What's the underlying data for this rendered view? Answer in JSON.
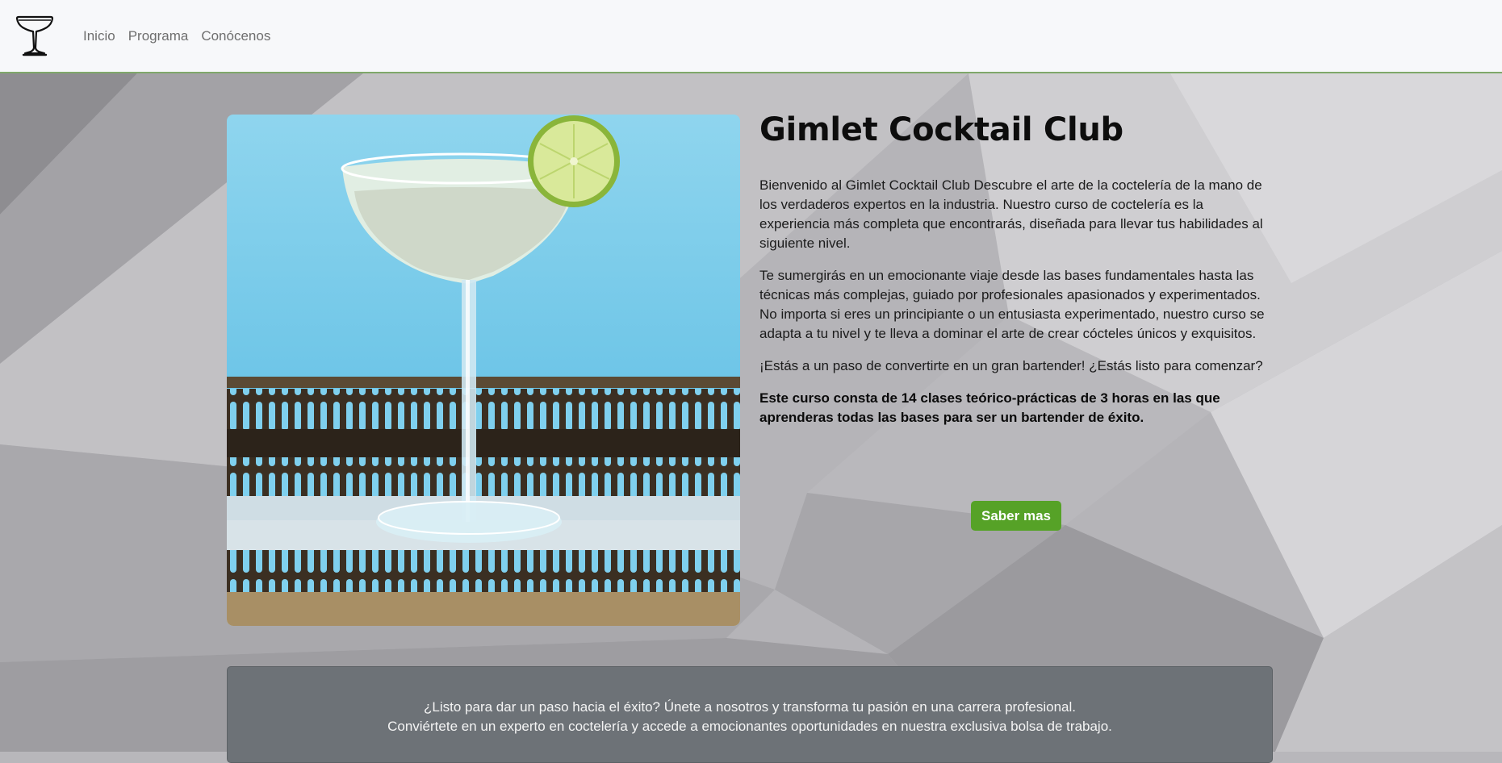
{
  "nav": {
    "brand_icon": "cocktail-glass-icon",
    "links": [
      {
        "label": "Inicio"
      },
      {
        "label": "Programa"
      },
      {
        "label": "Conócenos"
      }
    ]
  },
  "hero": {
    "title": "Gimlet Cocktail Club",
    "paragraphs": [
      "Bienvenido al Gimlet Cocktail Club Descubre el arte de la coctelería de la mano de los verdaderos expertos en la industria. Nuestro curso de coctelería es la experiencia más completa que encontrarás, diseñada para llevar tus habilidades al siguiente nivel.",
      "Te sumergirás en un emocionante viaje desde las bases fundamentales hasta las técnicas más complejas, guiado por profesionales apasionados y experimentados. No importa si eres un principiante o un entusiasta experimentado, nuestro curso se adapta a tu nivel y te lleva a dominar el arte de crear cócteles únicos y exquisitos.",
      "¡Estás a un paso de convertirte en un gran bartender! ¿Estás listo para comenzar?"
    ],
    "highlight": "Este curso consta de 14 clases teórico-prácticas de 3 horas en las que aprenderas todas las bases para ser un bartender de éxito.",
    "cta_label": "Saber mas",
    "image_icon": "gimlet-cocktail-photo"
  },
  "promo": {
    "line1": "¿Listo para dar un paso hacia el éxito? Únete a nosotros y transforma tu pasión en una carrera profesional.",
    "line2": "Conviértete en un experto en coctelería y accede a emocionantes oportunidades en nuestra exclusiva bolsa de trabajo."
  },
  "colors": {
    "accent": "#56a227",
    "nav_border": "#7fa86a",
    "promo_bg": "#6d7277"
  }
}
